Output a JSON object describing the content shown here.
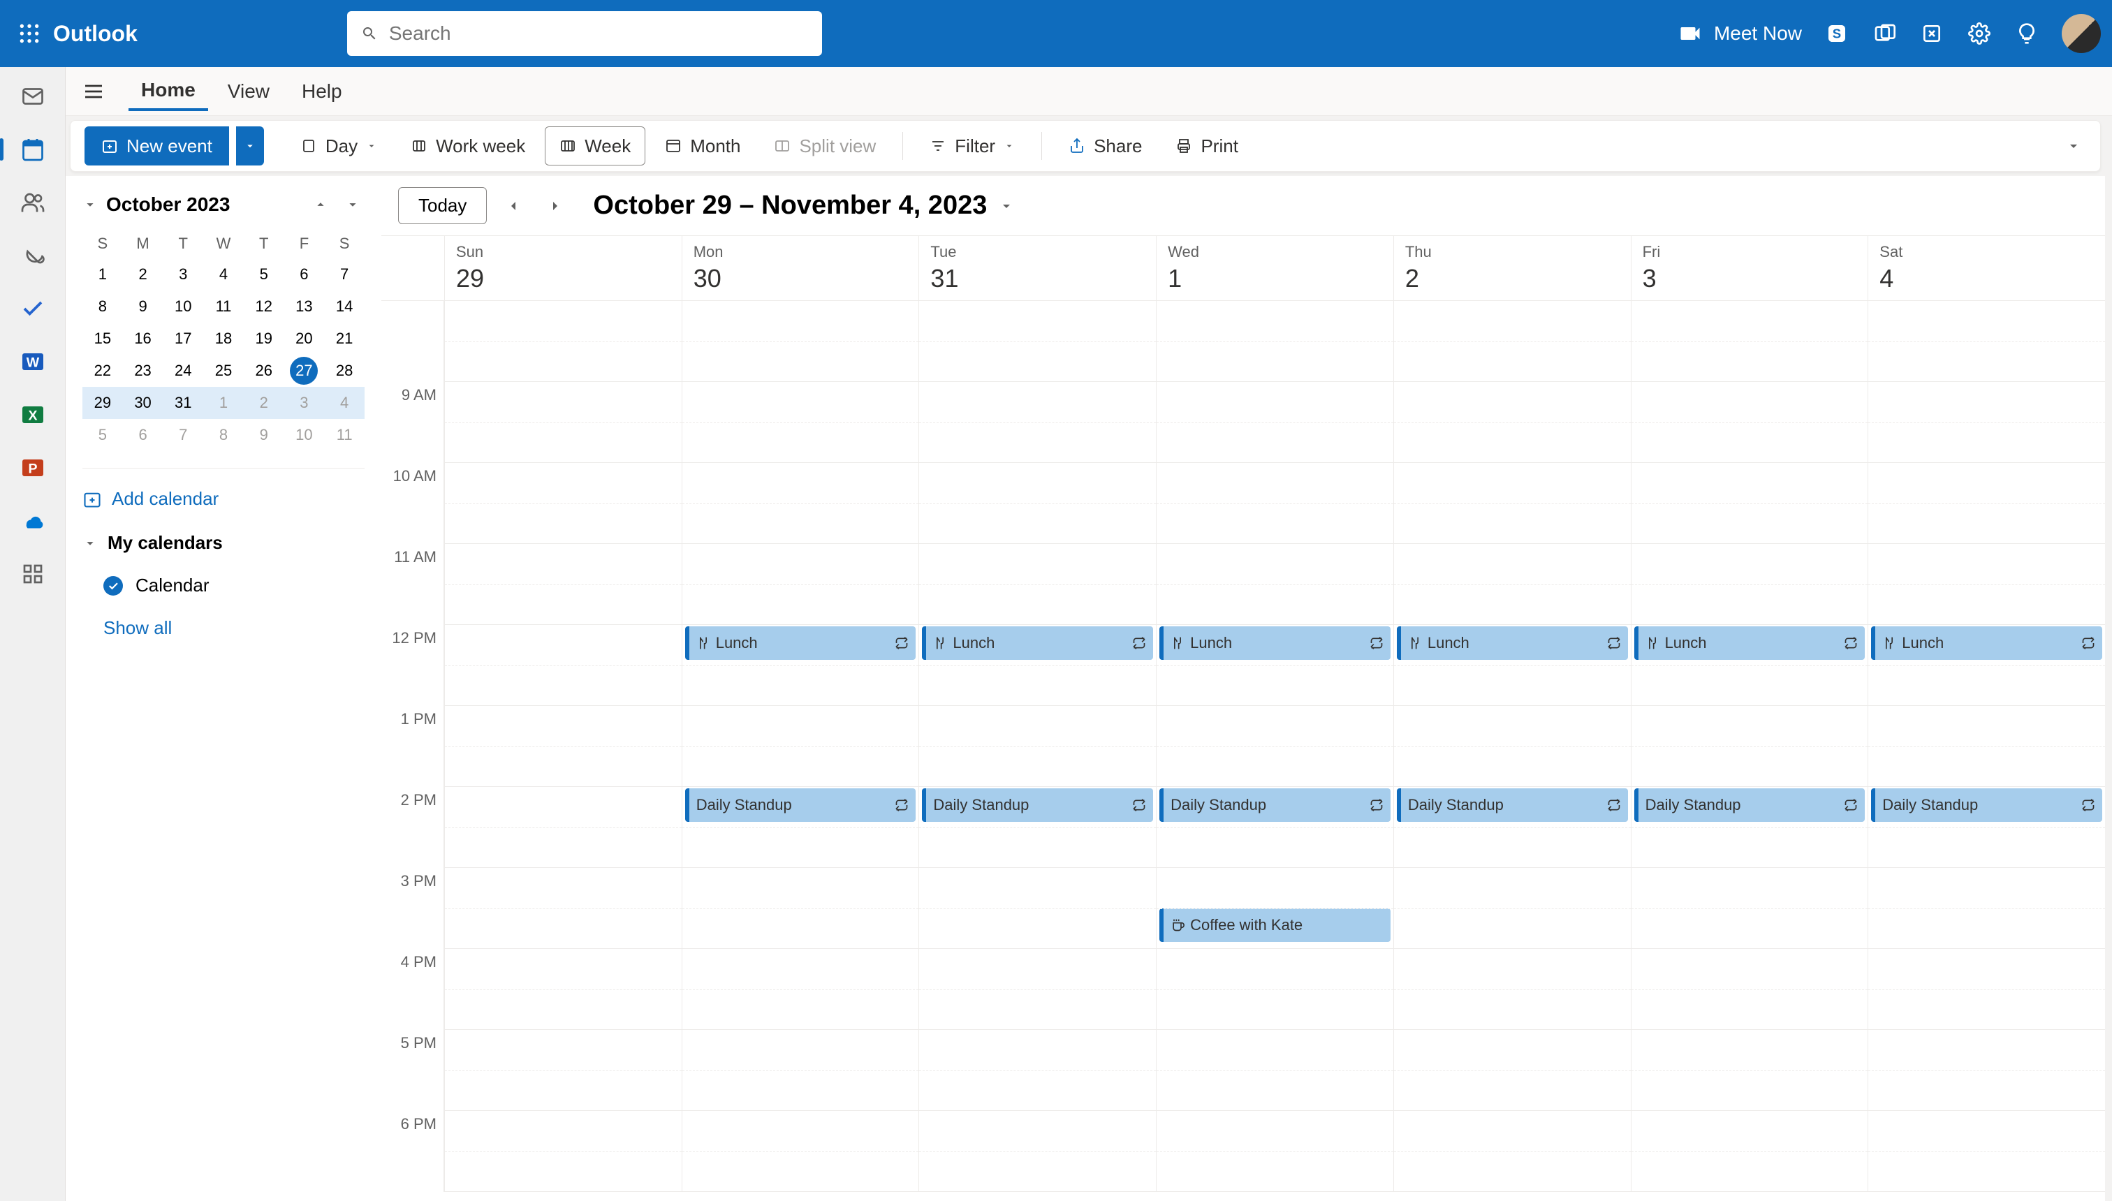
{
  "app_name": "Outlook",
  "search": {
    "placeholder": "Search"
  },
  "header": {
    "meet_now": "Meet Now"
  },
  "tabs": {
    "home": "Home",
    "view": "View",
    "help": "Help"
  },
  "toolbar": {
    "new_event": "New event",
    "day": "Day",
    "work_week": "Work week",
    "week": "Week",
    "month": "Month",
    "split_view": "Split view",
    "filter": "Filter",
    "share": "Share",
    "print": "Print"
  },
  "mini_cal": {
    "month_label": "October 2023",
    "dow": [
      "S",
      "M",
      "T",
      "W",
      "T",
      "F",
      "S"
    ],
    "rows": [
      [
        "1",
        "2",
        "3",
        "4",
        "5",
        "6",
        "7"
      ],
      [
        "8",
        "9",
        "10",
        "11",
        "12",
        "13",
        "14"
      ],
      [
        "15",
        "16",
        "17",
        "18",
        "19",
        "20",
        "21"
      ],
      [
        "22",
        "23",
        "24",
        "25",
        "26",
        "27",
        "28"
      ],
      [
        "29",
        "30",
        "31",
        "1",
        "2",
        "3",
        "4"
      ],
      [
        "5",
        "6",
        "7",
        "8",
        "9",
        "10",
        "11"
      ]
    ],
    "today": "27"
  },
  "sidebar": {
    "add_calendar": "Add calendar",
    "my_calendars": "My calendars",
    "calendar_item": "Calendar",
    "show_all": "Show all"
  },
  "main": {
    "today_btn": "Today",
    "range": "October 29 – November 4, 2023",
    "days": [
      {
        "name": "Sun",
        "num": "29"
      },
      {
        "name": "Mon",
        "num": "30"
      },
      {
        "name": "Tue",
        "num": "31"
      },
      {
        "name": "Wed",
        "num": "1"
      },
      {
        "name": "Thu",
        "num": "2"
      },
      {
        "name": "Fri",
        "num": "3"
      },
      {
        "name": "Sat",
        "num": "4"
      }
    ],
    "hours": [
      "",
      "9 AM",
      "10 AM",
      "11 AM",
      "12 PM",
      "1 PM",
      "2 PM",
      "3 PM",
      "4 PM",
      "5 PM",
      "6 PM"
    ]
  },
  "events": {
    "lunch": "Lunch",
    "standup": "Daily Standup",
    "coffee": "Coffee with Kate"
  }
}
